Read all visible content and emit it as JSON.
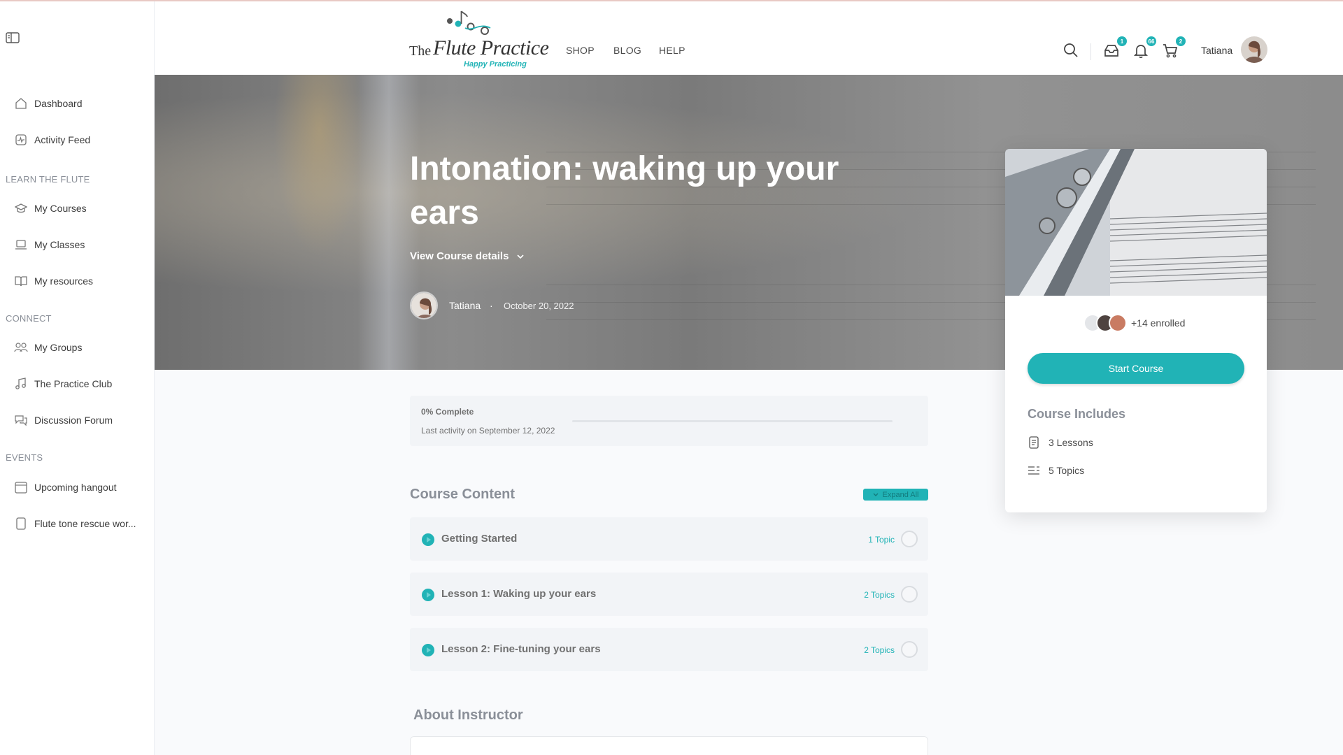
{
  "header": {
    "logo": {
      "the": "The",
      "main": "Flute Practice",
      "tagline": "Happy Practicing"
    },
    "nav": [
      {
        "label": "SHOP"
      },
      {
        "label": "BLOG"
      },
      {
        "label": "HELP"
      }
    ],
    "badges": {
      "messages": "1",
      "notifications": "66",
      "cart": "2"
    },
    "user_name": "Tatiana"
  },
  "sidebar": {
    "items_top": [
      {
        "label": "Dashboard",
        "icon": "home-icon"
      },
      {
        "label": "Activity Feed",
        "icon": "activity-icon"
      }
    ],
    "sections": [
      {
        "title": "LEARN THE FLUTE",
        "items": [
          {
            "label": "My Courses",
            "icon": "graduation-cap-icon"
          },
          {
            "label": "My Classes",
            "icon": "laptop-icon"
          },
          {
            "label": "My resources",
            "icon": "book-icon"
          }
        ]
      },
      {
        "title": "CONNECT",
        "items": [
          {
            "label": "My Groups",
            "icon": "users-icon"
          },
          {
            "label": "The Practice Club",
            "icon": "music-note-icon"
          },
          {
            "label": "Discussion Forum",
            "icon": "chat-icon"
          }
        ]
      },
      {
        "title": "EVENTS",
        "items": [
          {
            "label": "Upcoming hangout",
            "icon": "calendar-icon"
          },
          {
            "label": "Flute tone rescue wor...",
            "icon": "page-icon"
          }
        ]
      }
    ]
  },
  "hero": {
    "title": "Intonation: waking up your ears",
    "details_link": "View Course details",
    "author": "Tatiana",
    "separator": "·",
    "date": "October 20, 2022"
  },
  "card": {
    "enrolled": "+14 enrolled",
    "start_button": "Start Course",
    "includes_title": "Course Includes",
    "includes": [
      {
        "label": "3 Lessons",
        "icon": "document-icon"
      },
      {
        "label": "5 Topics",
        "icon": "list-icon"
      }
    ]
  },
  "progress": {
    "label": "0% Complete",
    "value": 0,
    "last_activity": "Last activity on September 12, 2022"
  },
  "course_content": {
    "title": "Course Content",
    "expand_label": "Expand All",
    "lessons": [
      {
        "title": "Getting Started",
        "topics": "1 Topic"
      },
      {
        "title": "Lesson 1: Waking up your ears",
        "topics": "2 Topics"
      },
      {
        "title": "Lesson 2: Fine-tuning your ears",
        "topics": "2 Topics"
      }
    ]
  },
  "about": {
    "title": "About Instructor"
  },
  "colors": {
    "accent": "#21b3b6",
    "sidebar_bg": "#ffffff",
    "page_bg": "#f9fafc"
  }
}
